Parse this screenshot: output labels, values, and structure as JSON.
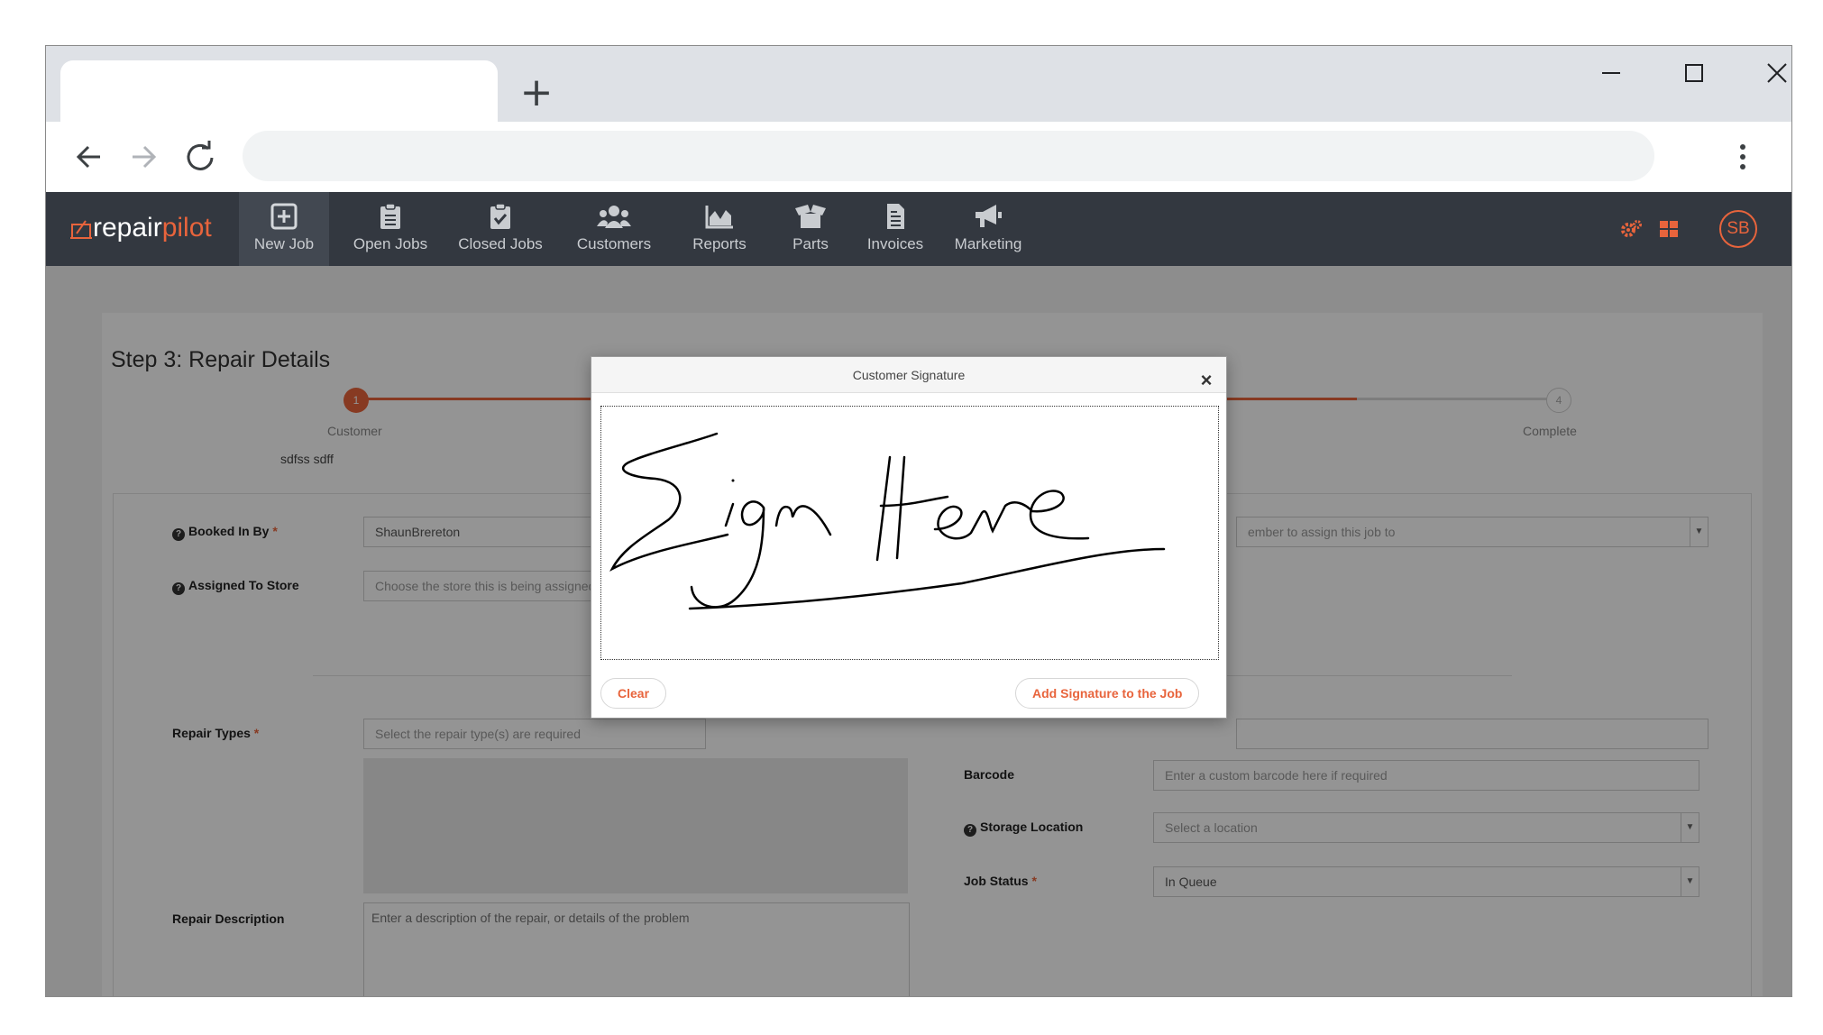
{
  "browser": {
    "newtab": "+",
    "omnibox": ""
  },
  "app": {
    "logo": {
      "part1": "repair",
      "part2": "pilot"
    },
    "nav": [
      {
        "label": "New Job",
        "icon": "plus-square-icon"
      },
      {
        "label": "Open Jobs",
        "icon": "clipboard-list-icon"
      },
      {
        "label": "Closed Jobs",
        "icon": "clipboard-check-icon"
      },
      {
        "label": "Customers",
        "icon": "users-icon"
      },
      {
        "label": "Reports",
        "icon": "area-chart-icon"
      },
      {
        "label": "Parts",
        "icon": "box-open-icon"
      },
      {
        "label": "Invoices",
        "icon": "file-invoice-icon"
      },
      {
        "label": "Marketing",
        "icon": "megaphone-icon"
      }
    ],
    "avatar": "SB"
  },
  "page": {
    "step_title": "Step 3: Repair Details",
    "steps": [
      {
        "num": "1",
        "label": "Customer",
        "value": "sdfss sdff"
      },
      {
        "num": "4",
        "label": "Complete"
      }
    ],
    "form": {
      "booked_in_by": {
        "label": "Booked In By",
        "value": "ShaunBrereton"
      },
      "assigned_to_store": {
        "label": "Assigned To Store",
        "placeholder": "Choose the store this is being assigned to"
      },
      "assign_member": {
        "placeholder": "ember to assign this job to"
      },
      "repair_types": {
        "label": "Repair Types",
        "placeholder": "Select the repair type(s) are required"
      },
      "barcode": {
        "label": "Barcode",
        "placeholder": "Enter a custom barcode here if required"
      },
      "storage_location": {
        "label": "Storage Location",
        "placeholder": "Select a location"
      },
      "job_status": {
        "label": "Job Status",
        "value": "In Queue"
      },
      "repair_description": {
        "label": "Repair Description",
        "placeholder": "Enter a description of the repair, or details of the problem"
      },
      "required_mark": "*"
    }
  },
  "modal": {
    "title": "Customer Signature",
    "close": "×",
    "clear_label": "Clear",
    "add_label": "Add Signature to the Job"
  },
  "colors": {
    "accent": "#e8643c",
    "nav_bg": "#333840"
  }
}
